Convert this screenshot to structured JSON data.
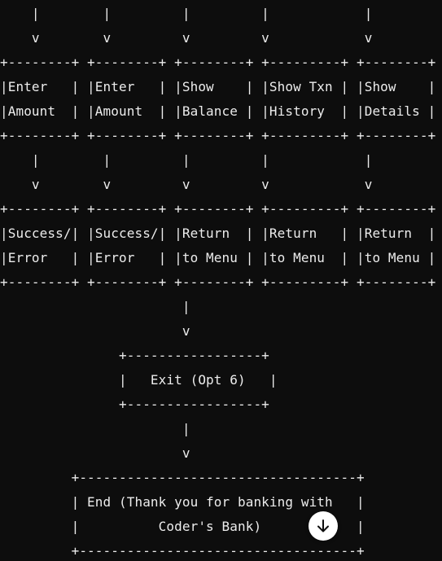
{
  "code_block": {
    "lines": [
      "    |        |         |         |            |",
      "    v        v         v         v            v",
      "+--------+ +--------+ +--------+ +---------+ +--------+",
      "|Enter   | |Enter   | |Show    | |Show Txn | |Show    |",
      "|Amount  | |Amount  | |Balance | |History  | |Details |",
      "+--------+ +--------+ +--------+ +---------+ +--------+",
      "    |        |         |         |            |",
      "    v        v         v         v            v",
      "+--------+ +--------+ +--------+ +---------+ +--------+",
      "|Success/| |Success/| |Return  | |Return   | |Return  |",
      "|Error   | |Error   | |to Menu | |to Menu  | |to Menu |",
      "+--------+ +--------+ +--------+ +---------+ +--------+",
      "                       |",
      "                       v",
      "               +-----------------+",
      "               |   Exit (Opt 6)   |",
      "               +-----------------+",
      "                       |",
      "                       v",
      "         +-----------------------------------+",
      "         | End (Thank you for banking with   |",
      "         |          Coder's Bank)            |",
      "         +-----------------------------------+"
    ]
  },
  "scroll_button": {
    "icon": "arrow-down-icon",
    "background": "#ffffff",
    "icon_color": "#0d0d0d"
  },
  "colors": {
    "background": "#0d0d0d",
    "text": "#ececec"
  }
}
